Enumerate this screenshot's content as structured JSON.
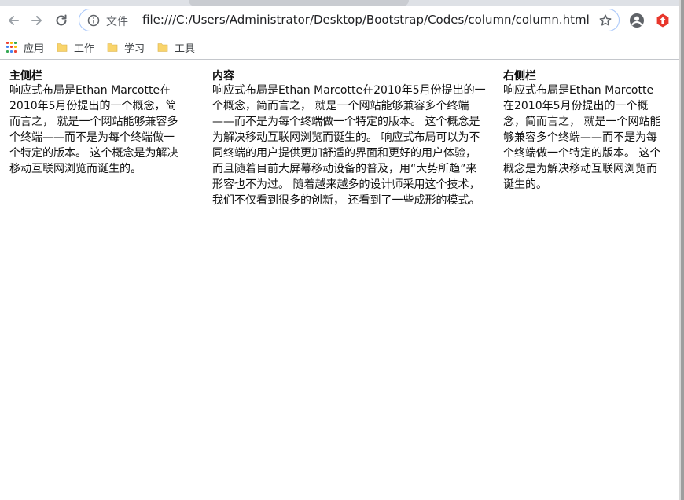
{
  "browser": {
    "address_chip": "文件",
    "url": "file:///C:/Users/Administrator/Desktop/Bootstrap/Codes/column/column.html",
    "icons": [
      "back-icon",
      "forward-icon",
      "reload-icon",
      "info-icon",
      "star-icon",
      "profile-icon",
      "extension-icon"
    ]
  },
  "bookmarks": [
    {
      "label": "应用",
      "icon": "apps-icon"
    },
    {
      "label": "工作",
      "icon": "folder-icon"
    },
    {
      "label": "学习",
      "icon": "folder-icon"
    },
    {
      "label": "工具",
      "icon": "folder-icon"
    }
  ],
  "colors": {
    "folder": "#f9d46b",
    "omnibox_border": "#a8c7fa",
    "extension_red": "#e8372c"
  },
  "page": {
    "left": {
      "title": "主侧栏",
      "text": "响应式布局是Ethan Marcotte在2010年5月份提出的一个概念，简而言之， 就是一个网站能够兼容多个终端——而不是为每个终端做一个特定的版本。 这个概念是为解决移动互联网浏览而诞生的。"
    },
    "main": {
      "title": "内容",
      "text": "响应式布局是Ethan Marcotte在2010年5月份提出的一个概念，简而言之， 就是一个网站能够兼容多个终端——而不是为每个终端做一个特定的版本。 这个概念是为解决移动互联网浏览而诞生的。 响应式布局可以为不同终端的用户提供更加舒适的界面和更好的用户体验， 而且随着目前大屏幕移动设备的普及，用“大势所趋”来形容也不为过。 随着越来越多的设计师采用这个技术，我们不仅看到很多的创新， 还看到了一些成形的模式。"
    },
    "right": {
      "title": "右侧栏",
      "text": "响应式布局是Ethan Marcotte在2010年5月份提出的一个概念，简而言之， 就是一个网站能够兼容多个终端——而不是为每个终端做一个特定的版本。 这个概念是为解决移动互联网浏览而诞生的。"
    }
  }
}
